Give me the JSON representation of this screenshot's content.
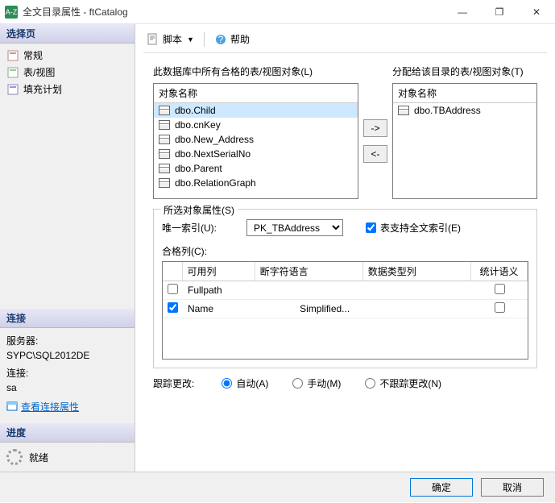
{
  "window": {
    "icon_label": "A-Z",
    "title": "全文目录属性 - ftCatalog",
    "min": "—",
    "max": "❐",
    "close": "✕"
  },
  "sidebar": {
    "select_page": "选择页",
    "nav": [
      {
        "label": "常规"
      },
      {
        "label": "表/视图"
      },
      {
        "label": "填充计划"
      }
    ],
    "connection_header": "连接",
    "server_label": "服务器:",
    "server_value": "SYPC\\SQL2012DE",
    "conn_label": "连接:",
    "conn_value": "sa",
    "view_props": "查看连接属性",
    "progress_header": "进度",
    "progress_status": "就绪"
  },
  "toolbar": {
    "script": "脚本",
    "dropdown": "▼",
    "help": "帮助"
  },
  "main": {
    "left_label": "此数据库中所有合格的表/视图对象(L)",
    "right_label": "分配给该目录的表/视图对象(T)",
    "col_object_name": "对象名称",
    "left_items": [
      "dbo.Child",
      "dbo.cnKey",
      "dbo.New_Address",
      "dbo.NextSerialNo",
      "dbo.Parent",
      "dbo.RelationGraph"
    ],
    "right_items": [
      "dbo.TBAddress"
    ],
    "move_right": "->",
    "move_left": "<-"
  },
  "props": {
    "group_title": "所选对象属性(S)",
    "unique_index_label": "唯一索引(U):",
    "unique_index_value": "PK_TBAddress",
    "support_ft_label": "表支持全文索引(E)",
    "support_ft_checked": true,
    "cols_label": "合格列(C):",
    "headers": {
      "col": "可用列",
      "lang": "断字符语言",
      "type": "数据类型列",
      "stat": "统计语义"
    },
    "rows": [
      {
        "checked": false,
        "col": "Fullpath",
        "lang": "",
        "type": "",
        "stat": false
      },
      {
        "checked": true,
        "col": "Name",
        "lang": "Simplified...",
        "type": "",
        "stat": false
      }
    ]
  },
  "tracking": {
    "label": "跟踪更改:",
    "auto": "自动(A)",
    "manual": "手动(M)",
    "none": "不跟踪更改(N)",
    "selected": "auto"
  },
  "footer": {
    "ok": "确定",
    "cancel": "取消"
  }
}
